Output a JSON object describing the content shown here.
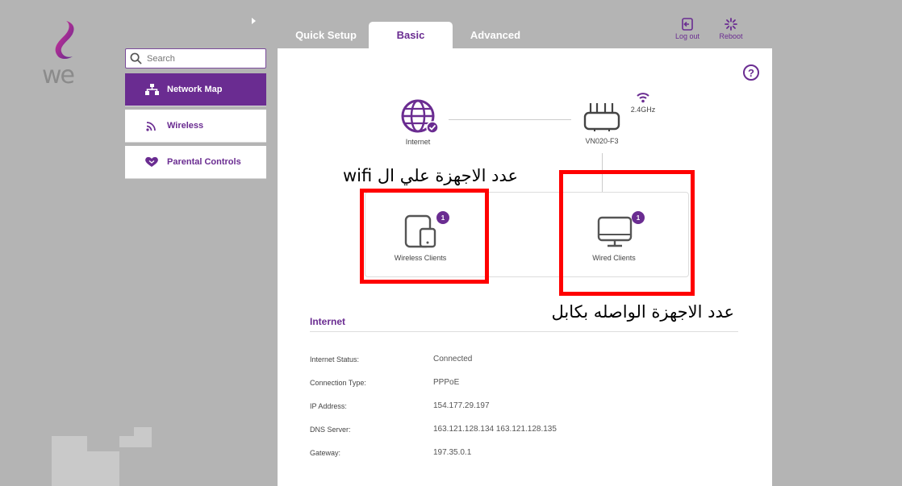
{
  "brand": {
    "logo_text": "we",
    "purple": "#6a2c91"
  },
  "search": {
    "placeholder": "Search"
  },
  "sidebar": {
    "items": [
      {
        "label": "Network Map",
        "icon": "network-icon",
        "active": true
      },
      {
        "label": "Wireless",
        "icon": "wifi-icon",
        "active": false
      },
      {
        "label": "Parental Controls",
        "icon": "heart-icon",
        "active": false
      }
    ]
  },
  "tabs": [
    {
      "label": "Quick Setup",
      "active": false
    },
    {
      "label": "Basic",
      "active": true
    },
    {
      "label": "Advanced",
      "active": false
    }
  ],
  "header": {
    "logout_label": "Log out",
    "reboot_label": "Reboot"
  },
  "network_map": {
    "internet_label": "Internet",
    "router_label": "VN020-F3",
    "band_label": "2.4GHz",
    "wireless_clients": {
      "label": "Wireless Clients",
      "count": "1"
    },
    "wired_clients": {
      "label": "Wired Clients",
      "count": "1"
    }
  },
  "annotations": {
    "wifi_devices": "عدد الاجهزة علي ال wifi",
    "cable_devices": "عدد الاجهزة الواصله بكابل",
    "highlight_color": "#ff0000"
  },
  "internet": {
    "title": "Internet",
    "rows": [
      {
        "label": "Internet Status:",
        "value": "Connected"
      },
      {
        "label": "Connection Type:",
        "value": "PPPoE"
      },
      {
        "label": "IP Address:",
        "value": "154.177.29.197"
      },
      {
        "label": "DNS Server:",
        "value": "163.121.128.134 163.121.128.135"
      },
      {
        "label": "Gateway:",
        "value": "197.35.0.1"
      }
    ]
  }
}
